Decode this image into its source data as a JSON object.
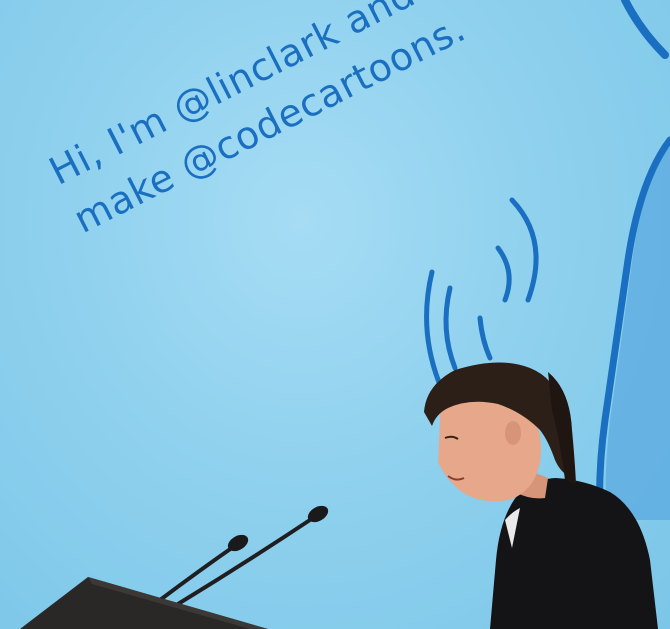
{
  "slide": {
    "line1": "Hi, I'm @linclark and I",
    "line2": "make @codecartoons."
  },
  "colors": {
    "screen": "#8fd1ee",
    "slide_ink": "#1a6fc0",
    "podium": "#2a2826",
    "jacket": "#141417",
    "hair": "#2b1f18",
    "skin": "#e6a78a"
  }
}
